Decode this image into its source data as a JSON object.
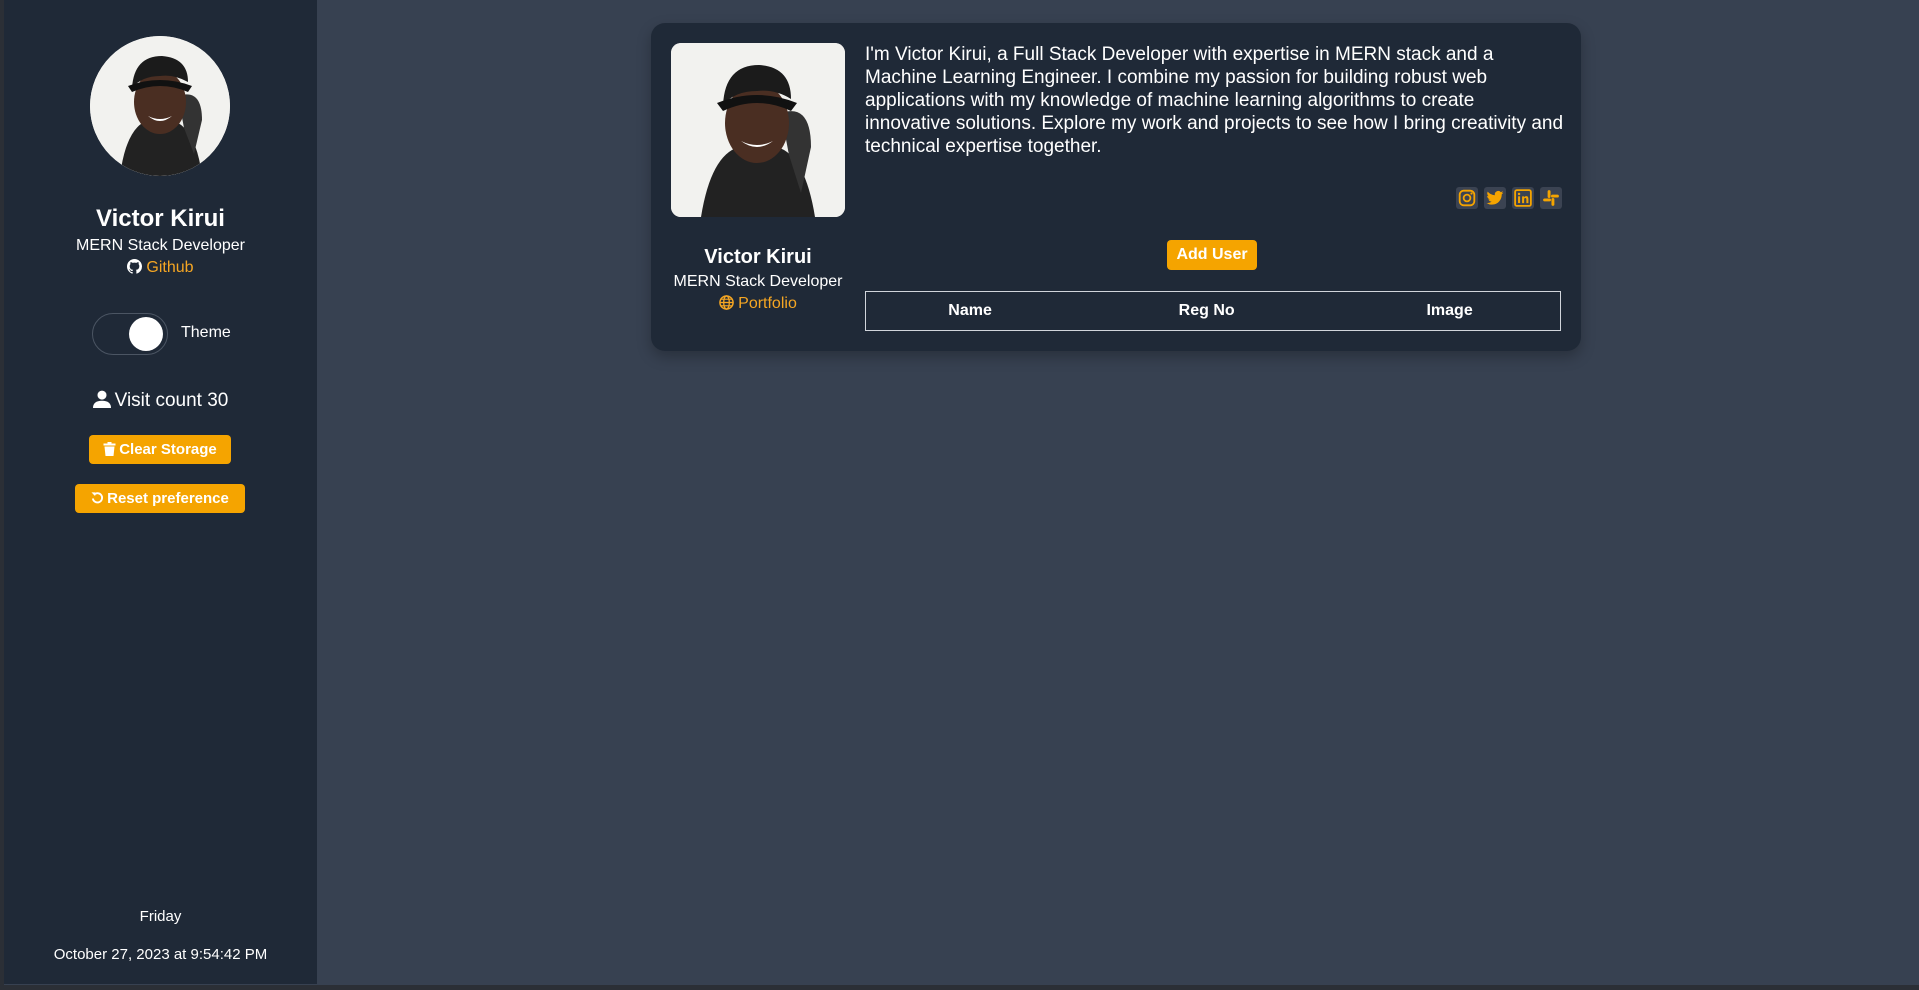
{
  "sidebar": {
    "name": "Victor Kirui",
    "role": "MERN Stack Developer",
    "github_label": "Github",
    "theme_label": "Theme",
    "theme_on": true,
    "visit_label": "Visit count",
    "visit_count": "30",
    "clear_storage_label": "Clear Storage",
    "reset_preference_label": "Reset preference",
    "day": "Friday",
    "datetime": "October 27, 2023 at 9:54:42 PM"
  },
  "card": {
    "name": "Victor Kirui",
    "role": "MERN Stack Developer",
    "portfolio_label": "Portfolio",
    "bio": "I'm Victor Kirui, a Full Stack Developer with expertise in MERN stack and a Machine Learning Engineer. I combine my passion for building robust web applications with my knowledge of machine learning algorithms to create innovative solutions. Explore my work and projects to see how I bring creativity and technical expertise together.",
    "socials": [
      "instagram-icon",
      "twitter-icon",
      "linkedin-icon",
      "slack-icon"
    ],
    "add_user_label": "Add User",
    "table": {
      "headers": [
        "Name",
        "Reg No",
        "Image"
      ],
      "rows": []
    }
  },
  "colors": {
    "page_bg": "#374151",
    "panel_bg": "#1f2937",
    "accent": "#f5a400",
    "text": "#ffffff"
  }
}
